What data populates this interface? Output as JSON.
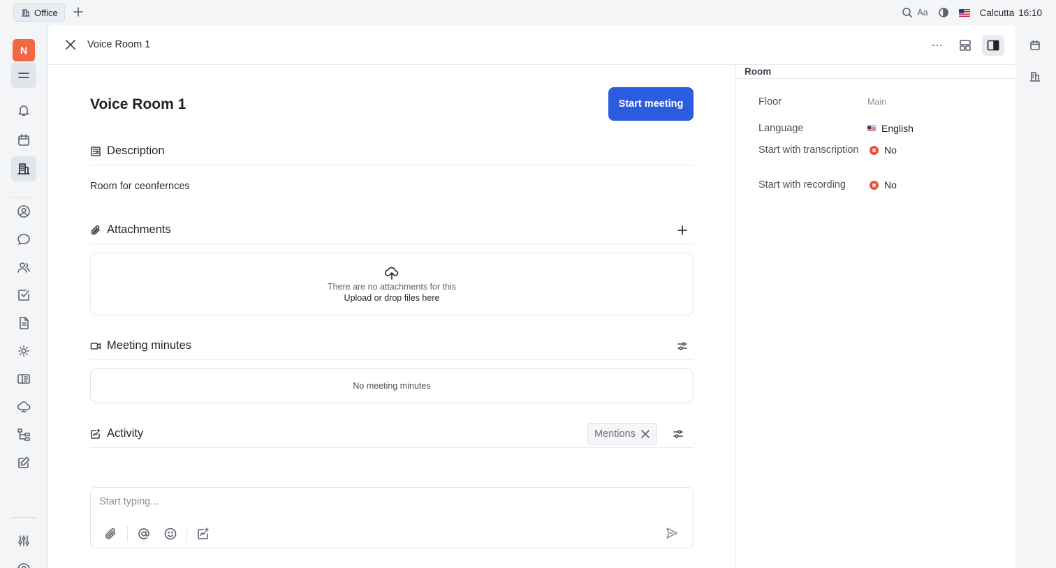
{
  "topbar": {
    "tab_label": "Office",
    "location": "Calcutta",
    "time": "16:10",
    "font_size_label": "Aa"
  },
  "leftnav": {
    "avatar_initial": "N",
    "avatar_color": "#f26844",
    "items": [
      "menu-icon",
      "bell-icon",
      "calendar-icon",
      "office-icon",
      "person-circle-icon",
      "chat-icon",
      "contacts-icon",
      "tasks-icon",
      "document-icon",
      "sun-icon",
      "book-icon",
      "cloud-icon",
      "hierarchy-icon",
      "edit-icon",
      "settings-sliders-icon",
      "help-icon"
    ]
  },
  "header": {
    "title": "Voice Room 1"
  },
  "main": {
    "title": "Voice Room 1",
    "start_button": "Start meeting",
    "description_label": "Description",
    "description_text": "Room for ceonfernces",
    "attachments_label": "Attachments",
    "attachments_empty": "There are no attachments for this",
    "attachments_upload": "Upload or drop files here",
    "minutes_label": "Meeting minutes",
    "minutes_empty": "No meeting minutes",
    "activity_label": "Activity",
    "mentions_chip": "Mentions",
    "composer_placeholder": "Start typing..."
  },
  "attributes": {
    "heading": "Room",
    "rows": [
      {
        "label": "Floor",
        "value": "Main"
      },
      {
        "label": "Language",
        "value": "English"
      },
      {
        "label": "Start with transcription",
        "value": "No"
      },
      {
        "label": "Start with recording",
        "value": "No"
      }
    ]
  },
  "colors": {
    "accent": "#2b5bde",
    "negative": "#e5533d"
  }
}
